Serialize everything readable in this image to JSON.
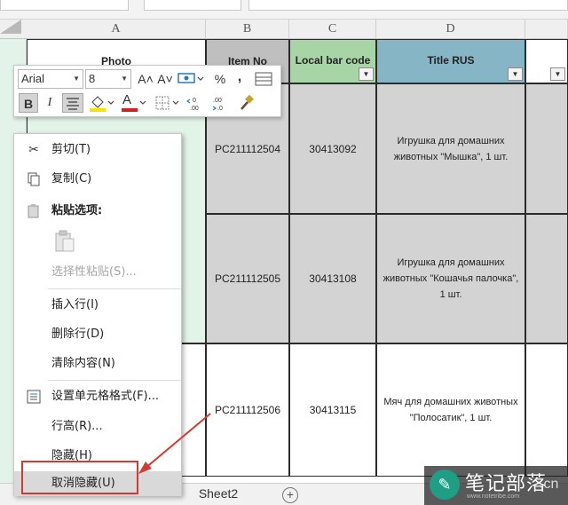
{
  "toolbar": {
    "font_name": "Arial",
    "font_size": "8",
    "increase_font": "A˄",
    "decrease_font": "A˅",
    "percent": "%",
    "comma": ",",
    "bold": "B",
    "italic": "I",
    "font_color_letter": "A",
    "fill_color": "#f5e300",
    "font_color": "#d21f1f"
  },
  "columns": [
    "A",
    "B",
    "C",
    "D"
  ],
  "header_row": {
    "photo": "Photo",
    "item_no": "Item No",
    "local_bar_code": "Local bar code",
    "title_rus": "Title RUS",
    "filter_symbol": "▼"
  },
  "rows": [
    {
      "item_no": "PC211112504",
      "bar_code": "30413092",
      "title": "Игрушка для домашних животных \"Мышка\", 1 шт."
    },
    {
      "item_no": "PC211112505",
      "bar_code": "30413108",
      "title": "Игрушка для домашних животных \"Кошачья палочка\", 1 шт."
    },
    {
      "item_no": "PC211112506",
      "bar_code": "30413115",
      "title": "Мяч для домашних животных \"Полосатик\", 1 шт."
    }
  ],
  "context_menu": {
    "cut": "剪切(T)",
    "copy": "复制(C)",
    "paste_options": "粘贴选项:",
    "paste_special": "选择性粘贴(S)...",
    "insert_row": "插入行(I)",
    "delete_row": "删除行(D)",
    "clear_contents": "清除内容(N)",
    "format_cells": "设置单元格格式(F)...",
    "row_height": "行高(R)...",
    "hide": "隐藏(H)",
    "unhide": "取消隐藏(U)"
  },
  "sheet_tabs": {
    "sheet2": "Sheet2",
    "add": "+"
  },
  "watermark": {
    "logo": "✎",
    "name": "笔记部落",
    "suffix": ".cn",
    "url": "www.notetribe.com"
  },
  "colors": {
    "bar_code_header": "#a8d5a6",
    "title_header": "#86b6c6",
    "item_header": "#bfbfbf",
    "gray_cell": "#d3d3d3",
    "highlight": "#d43a33"
  }
}
